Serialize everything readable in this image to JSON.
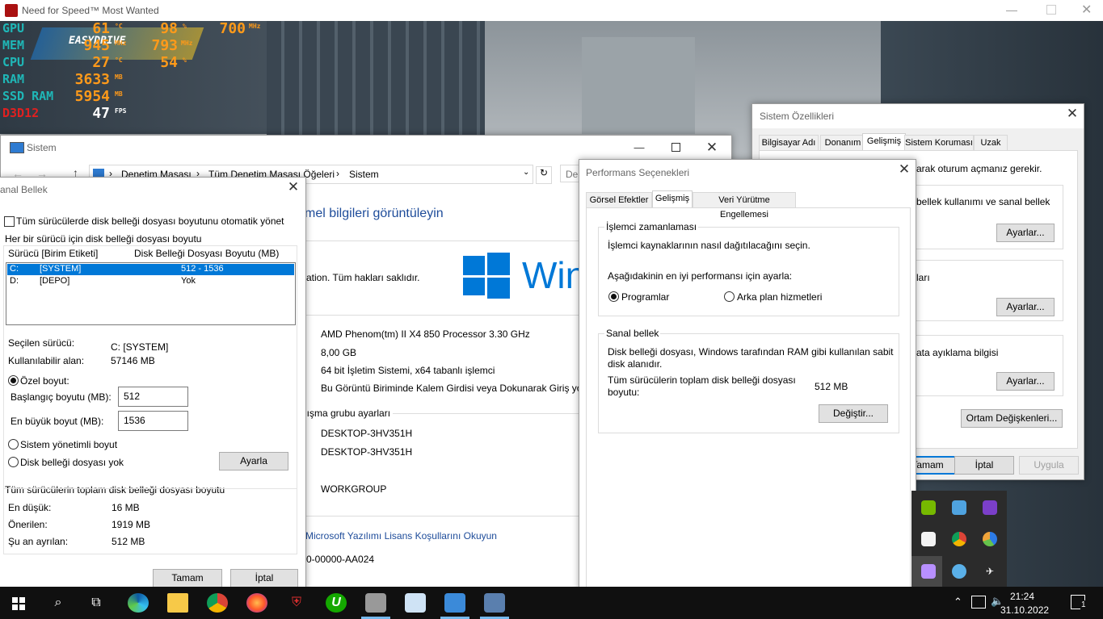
{
  "game": {
    "title": "Need for Speed™ Most Wanted",
    "osd": {
      "gpu": {
        "label": "GPU",
        "temp": "61",
        "temp_unit": "°C",
        "load": "98",
        "load_unit": "%",
        "clock": "700",
        "clock_unit": "MHz"
      },
      "mem": {
        "label": "MEM",
        "clock": "945",
        "clock_unit": "MHz",
        "extra": "793",
        "extra_unit": "MHz"
      },
      "cpu": {
        "label": "CPU",
        "temp": "27",
        "temp_unit": "°C",
        "load": "54",
        "load_unit": "%"
      },
      "ram": {
        "label": "RAM",
        "value": "3633",
        "unit": "MB"
      },
      "ssd": {
        "label": "SSD RAM",
        "value": "5954",
        "unit": "MB"
      },
      "d3d": {
        "label": "D3D12",
        "value": "47",
        "unit": "FPS"
      },
      "logo": "EASYDRIVE"
    }
  },
  "system_window": {
    "title": "Sistem",
    "breadcrumb": [
      "Denetim Masası",
      "Tüm Denetim Masası Öğeleri",
      "Sistem"
    ],
    "search_placeholder": "Der",
    "heading": "mel bilgileri görüntüleyin",
    "copyright": "ation. Tüm hakları saklıdır.",
    "windows_logo_text": "Win",
    "processor": "AMD Phenom(tm) II X4 850 Processor   3.30 GHz",
    "ram": "8,00 GB",
    "system_type": "64 bit İşletim Sistemi, x64 tabanlı işlemci",
    "pen": "Bu Görüntü Biriminde Kalem Girdisi veya Dokunarak Giriş yok",
    "section_workgroup": "lışma grubu ayarları",
    "computer_name": "DESKTOP-3HV351H",
    "full_name": "DESKTOP-3HV351H",
    "workgroup": "WORKGROUP",
    "license_link": "Microsoft Yazılımı Lisans Koşullarını Okuyun",
    "product_id": "0-00000-AA024"
  },
  "virtual_memory": {
    "title": "anal Bellek",
    "auto_manage": "Tüm sürücülerde disk belleği dosyası boyutunu otomatik yönet",
    "per_drive_label": "Her bir sürücü için disk belleği dosyası boyutu",
    "col_drive": "Sürücü  [Birim Etiketi]",
    "col_size": "Disk Belleği Dosyası Boyutu (MB)",
    "drives": [
      {
        "letter": "C:",
        "label": "[SYSTEM]",
        "size": "512 - 1536"
      },
      {
        "letter": "D:",
        "label": "[DEPO]",
        "size": "Yok"
      }
    ],
    "selected_drive_label": "Seçilen sürücü:",
    "selected_drive_value": "C:  [SYSTEM]",
    "available_label": "Kullanılabilir alan:",
    "available_value": "57146 MB",
    "custom_size": "Özel boyut:",
    "initial_label": "Başlangıç boyutu (MB):",
    "initial_value": "512",
    "max_label": "En büyük boyut (MB):",
    "max_value": "1536",
    "system_managed": "Sistem yönetimli boyut",
    "no_paging": "Disk belleği dosyası yok",
    "set_button": "Ayarla",
    "total_label": "Tüm sürücülerin toplam disk belleği dosyası boyutu",
    "min_label": "En düşük:",
    "min_value": "16 MB",
    "recommended_label": "Önerilen:",
    "recommended_value": "1919 MB",
    "current_label": "Şu an ayrılan:",
    "current_value": "512 MB",
    "ok_button": "Tamam",
    "cancel_button": "İptal"
  },
  "performance": {
    "title": "Performans Seçenekleri",
    "tabs": [
      "Görsel Efektler",
      "Gelişmiş",
      "Veri Yürütme Engellemesi"
    ],
    "scheduling_title": "İşlemci zamanlaması",
    "scheduling_desc": "İşlemci kaynaklarının nasıl dağıtılacağını seçin.",
    "adjust_label": "Aşağıdakinin en iyi performansı için ayarla:",
    "programs": "Programlar",
    "background": "Arka plan hizmetleri",
    "vm_title": "Sanal bellek",
    "vm_desc1": "Disk belleği dosyası, Windows tarafından RAM gibi kullanılan sabit",
    "vm_desc2": "disk alanıdır.",
    "vm_total1": "Tüm sürücülerin toplam disk belleği dosyası",
    "vm_total2": "boyutu:",
    "vm_total_value": "512 MB",
    "change_button": "Değiştir..."
  },
  "system_properties": {
    "title": "Sistem Özellikleri",
    "tabs": [
      "Bilgisayar Adı",
      "Donanım",
      "Gelişmiş",
      "Sistem Koruması",
      "Uzak"
    ],
    "admin_note": "arak oturum açmanız gerekir.",
    "perf_desc": "bellek kullanımı ve sanal bellek",
    "settings1": "Ayarlar...",
    "profile_desc": "ları",
    "settings2": "Ayarlar...",
    "startup_desc": "ata ayıklama bilgisi",
    "settings3": "Ayarlar...",
    "env_button": "Ortam Değişkenleri...",
    "ok_button": "Tamam",
    "cancel_button": "İptal",
    "apply_button": "Uygula"
  },
  "taskbar": {
    "time": "21:24",
    "date": "31.10.2022",
    "notification_count": "1"
  }
}
